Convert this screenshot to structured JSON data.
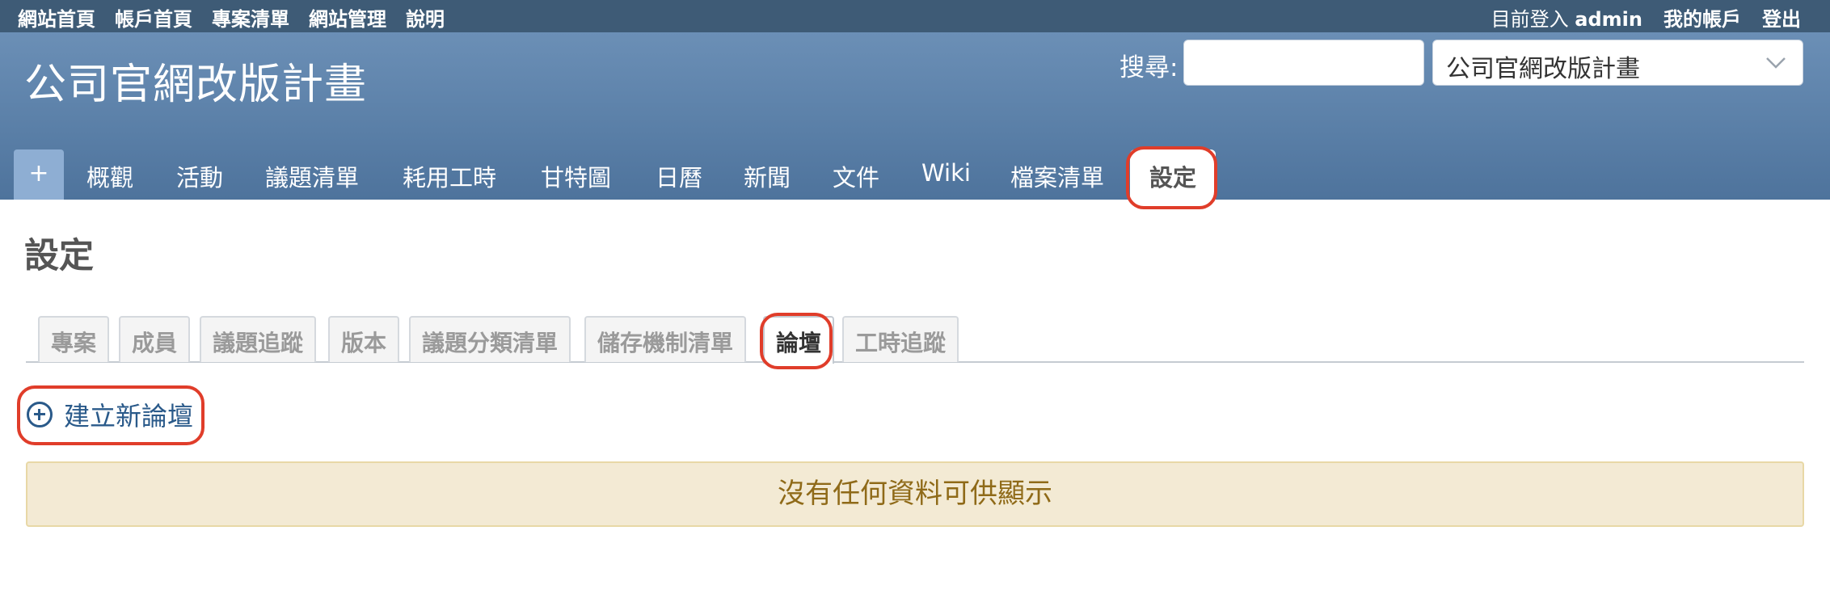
{
  "topbar": {
    "left_menu": [
      "網站首頁",
      "帳戶首頁",
      "專案清單",
      "網站管理",
      "說明"
    ],
    "logged_prefix": "目前登入",
    "user": "admin",
    "my_account": "我的帳戶",
    "logout": "登出"
  },
  "header": {
    "project_title": "公司官網改版計畫",
    "search_label": "搜尋:",
    "search_value": "",
    "jump_selected": "公司官網改版計畫"
  },
  "main_tabs": {
    "plus": "+",
    "items": [
      "概觀",
      "活動",
      "議題清單",
      "耗用工時",
      "甘特圖",
      "日曆",
      "新聞",
      "文件",
      "Wiki",
      "檔案清單",
      "設定"
    ],
    "selected": "設定"
  },
  "page": {
    "heading": "設定"
  },
  "settings_tabs": {
    "items": [
      "專案",
      "成員",
      "議題追蹤",
      "版本",
      "議題分類清單",
      "儲存機制清單",
      "論壇",
      "工時追蹤"
    ],
    "selected": "論壇"
  },
  "actions": {
    "new_forum": "建立新論壇"
  },
  "message": {
    "no_data": "沒有任何資料可供顯示"
  },
  "colors": {
    "highlight": "#e03d2a",
    "header": "#5b80a8",
    "nodata_bg": "#f3ead4"
  },
  "icons": {
    "new_forum": "plus-circle-icon",
    "dropdown": "chevron-down-icon"
  }
}
